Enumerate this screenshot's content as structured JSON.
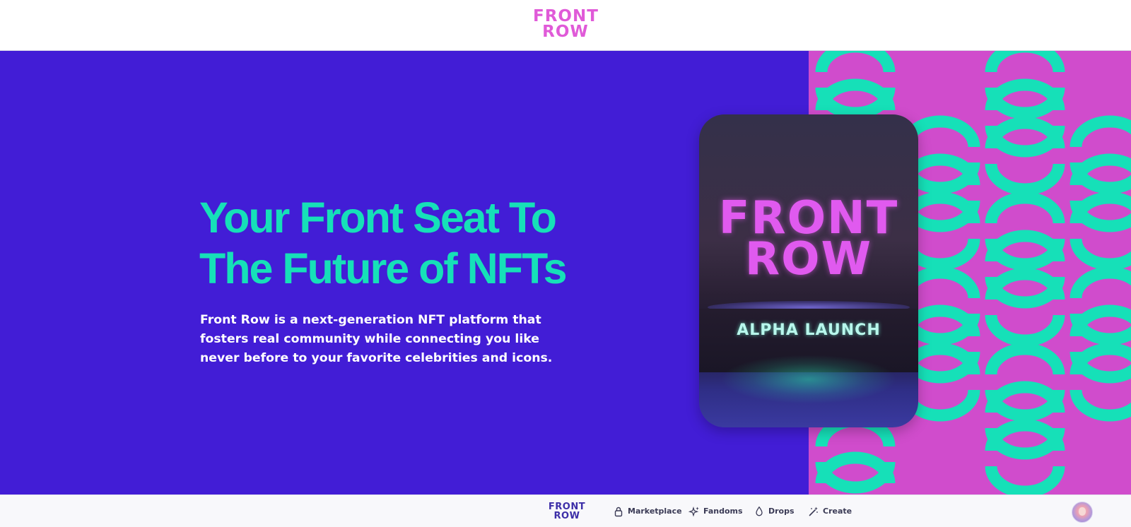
{
  "header": {
    "logo_line1": "FRONT",
    "logo_line2": "ROW"
  },
  "hero": {
    "headline_line1": "Your Front Seat To",
    "headline_line2": "The Future of NFTs",
    "description": "Front Row is a next-generation NFT platform that fosters real community while connecting you like never before to your favorite celebrities and icons."
  },
  "card": {
    "logo_line1": "FRONT",
    "logo_line2": "ROW",
    "caption": "ALPHA LAUNCH"
  },
  "bottom_nav": {
    "logo_line1": "FRONT",
    "logo_line2": "ROW",
    "items": [
      {
        "label": "Marketplace",
        "icon": "lock-icon"
      },
      {
        "label": "Fandoms",
        "icon": "sparkles-icon"
      },
      {
        "label": "Drops",
        "icon": "droplet-icon"
      },
      {
        "label": "Create",
        "icon": "magic-wand-icon"
      }
    ]
  },
  "colors": {
    "hero_bg": "#421dd6",
    "accent_teal": "#16e0b8",
    "brand_pink": "#e05ad8",
    "pattern_bg": "#d04ccc"
  }
}
